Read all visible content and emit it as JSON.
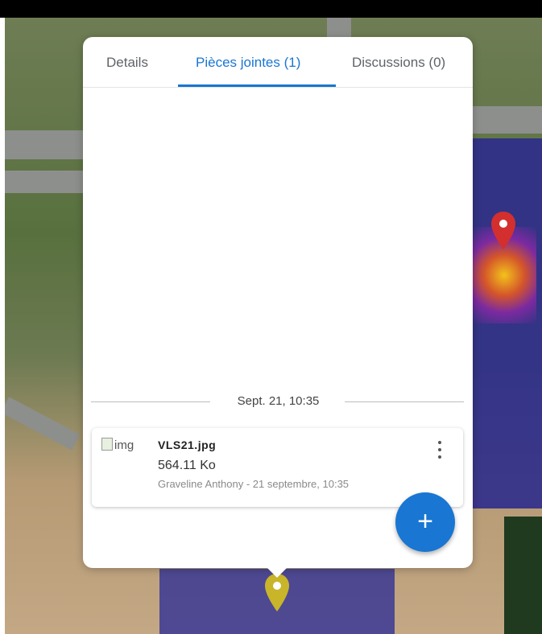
{
  "tabs": [
    {
      "label": "Details",
      "active": false
    },
    {
      "label": "Pièces jointes (1)",
      "active": true
    },
    {
      "label": "Discussions (0)",
      "active": false
    }
  ],
  "timeline_label": "Sept. 21, 10:35",
  "attachment": {
    "thumbnail_alt": "img",
    "file_name": "VLS21.jpg",
    "file_size": "564.11 Ko",
    "meta": "Graveline Anthony - 21 septembre, 10:35"
  },
  "add_button_label": "+",
  "icons": {
    "menu": "more-vert-icon",
    "add": "plus-icon",
    "pins": [
      "red-map-pin-icon",
      "yellow-map-pin-icon"
    ]
  },
  "colors": {
    "accent": "#1976d2",
    "pin_red": "#d32f2f",
    "pin_yellow": "#c8b52a",
    "heatmap": "#2b2a8a"
  }
}
